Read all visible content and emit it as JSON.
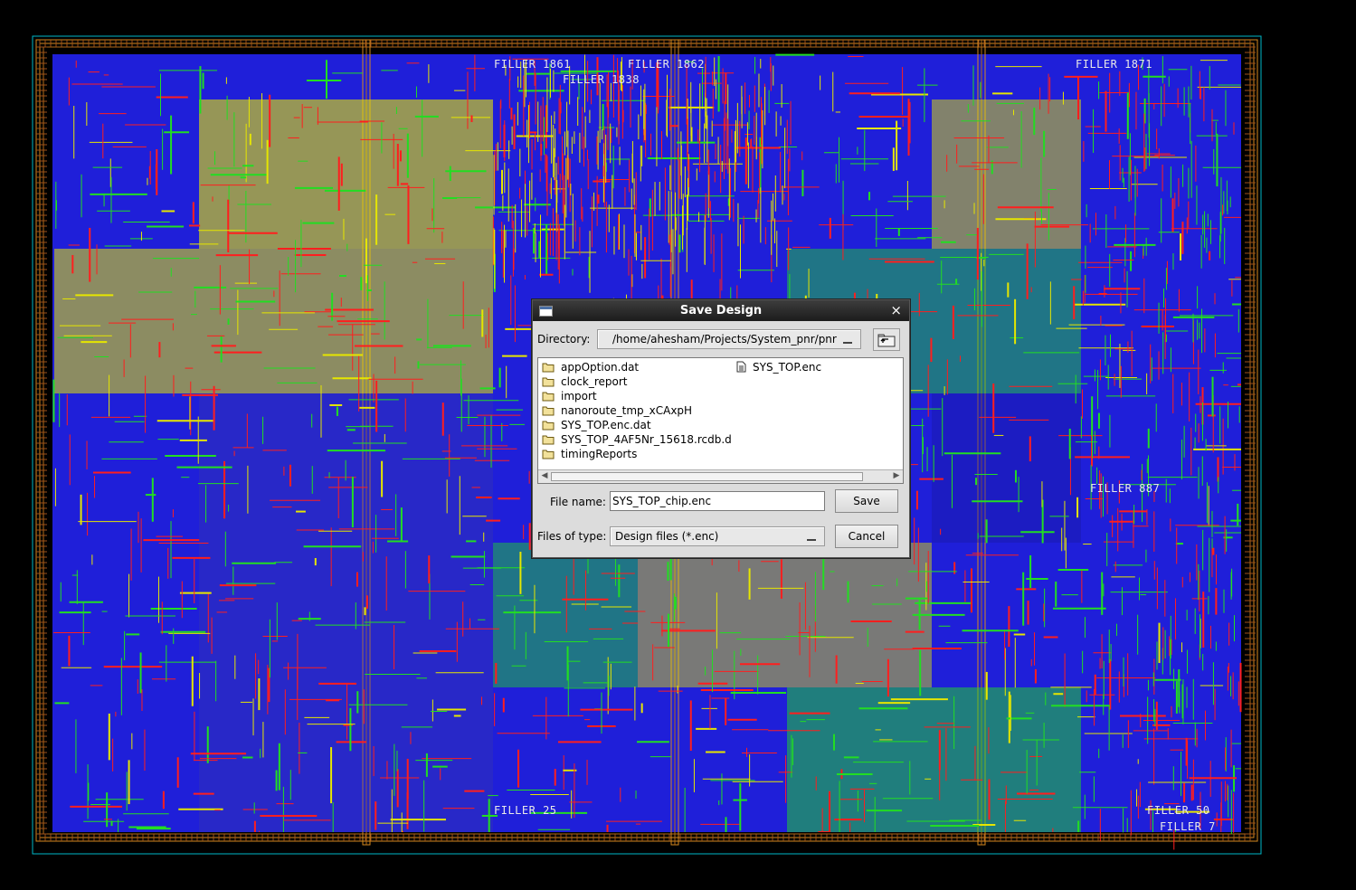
{
  "canvas": {
    "filler_labels": [
      "FILLER 1861",
      "FILLER 1862",
      "FILLER 1838",
      "FILLER 1871",
      "FILLER 887",
      "FILLER 25",
      "FILLER 50",
      "FILLER 7"
    ],
    "colors": {
      "background": "#000000",
      "metal_blue": "#2424ff",
      "metal_red": "#ff1e1e",
      "metal_green": "#22dd22",
      "metal_yellow": "#e6e600",
      "power_ring": "#d4881e",
      "boundary": "#00b8c8"
    }
  },
  "dialog": {
    "title": "Save Design",
    "close_icon": "close-icon",
    "directory_label": "Directory:",
    "directory_value": "/home/ahesham/Projects/System_pnr/pnr",
    "parent_dir_icon": "folder-up-icon",
    "files": [
      {
        "name": "appOption.dat",
        "type": "folder"
      },
      {
        "name": "clock_report",
        "type": "folder"
      },
      {
        "name": "import",
        "type": "folder"
      },
      {
        "name": "nanoroute_tmp_xCAxpH",
        "type": "folder"
      },
      {
        "name": "SYS_TOP.enc.dat",
        "type": "folder"
      },
      {
        "name": "SYS_TOP_4AF5Nr_15618.rcdb.d",
        "type": "folder"
      },
      {
        "name": "timingReports",
        "type": "folder"
      },
      {
        "name": "SYS_TOP.enc",
        "type": "file"
      }
    ],
    "file_name_label": "File name:",
    "file_name_value": "SYS_TOP_chip.enc",
    "files_of_type_label": "Files of type:",
    "files_of_type_value": "Design files (*.enc)",
    "save_label": "Save",
    "cancel_label": "Cancel"
  }
}
